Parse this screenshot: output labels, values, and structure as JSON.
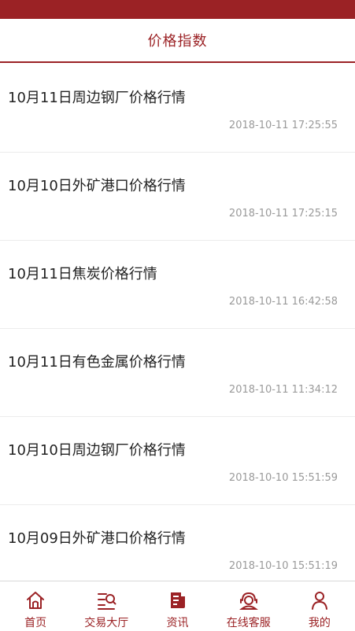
{
  "header": {
    "title": "价格指数"
  },
  "articles": [
    {
      "title": "10月11日周边钢厂价格行情",
      "date": "2018-10-11 17:25:55"
    },
    {
      "title": "10月10日外矿港口价格行情",
      "date": "2018-10-11 17:25:15"
    },
    {
      "title": "10月11日焦炭价格行情",
      "date": "2018-10-11 16:42:58"
    },
    {
      "title": "10月11日有色金属价格行情",
      "date": "2018-10-11 11:34:12"
    },
    {
      "title": "10月10日周边钢厂价格行情",
      "date": "2018-10-10 15:51:59"
    },
    {
      "title": "10月09日外矿港口价格行情",
      "date": "2018-10-10 15:51:19"
    }
  ],
  "tabbar": {
    "items": [
      {
        "label": "首页",
        "icon": "home-icon"
      },
      {
        "label": "交易大厅",
        "icon": "trading-hall-icon"
      },
      {
        "label": "资讯",
        "icon": "news-icon"
      },
      {
        "label": "在线客服",
        "icon": "customer-service-icon"
      },
      {
        "label": "我的",
        "icon": "profile-icon"
      }
    ]
  },
  "colors": {
    "brand": "#9b2225",
    "text": "#222222",
    "muted": "#9a9a9a"
  }
}
